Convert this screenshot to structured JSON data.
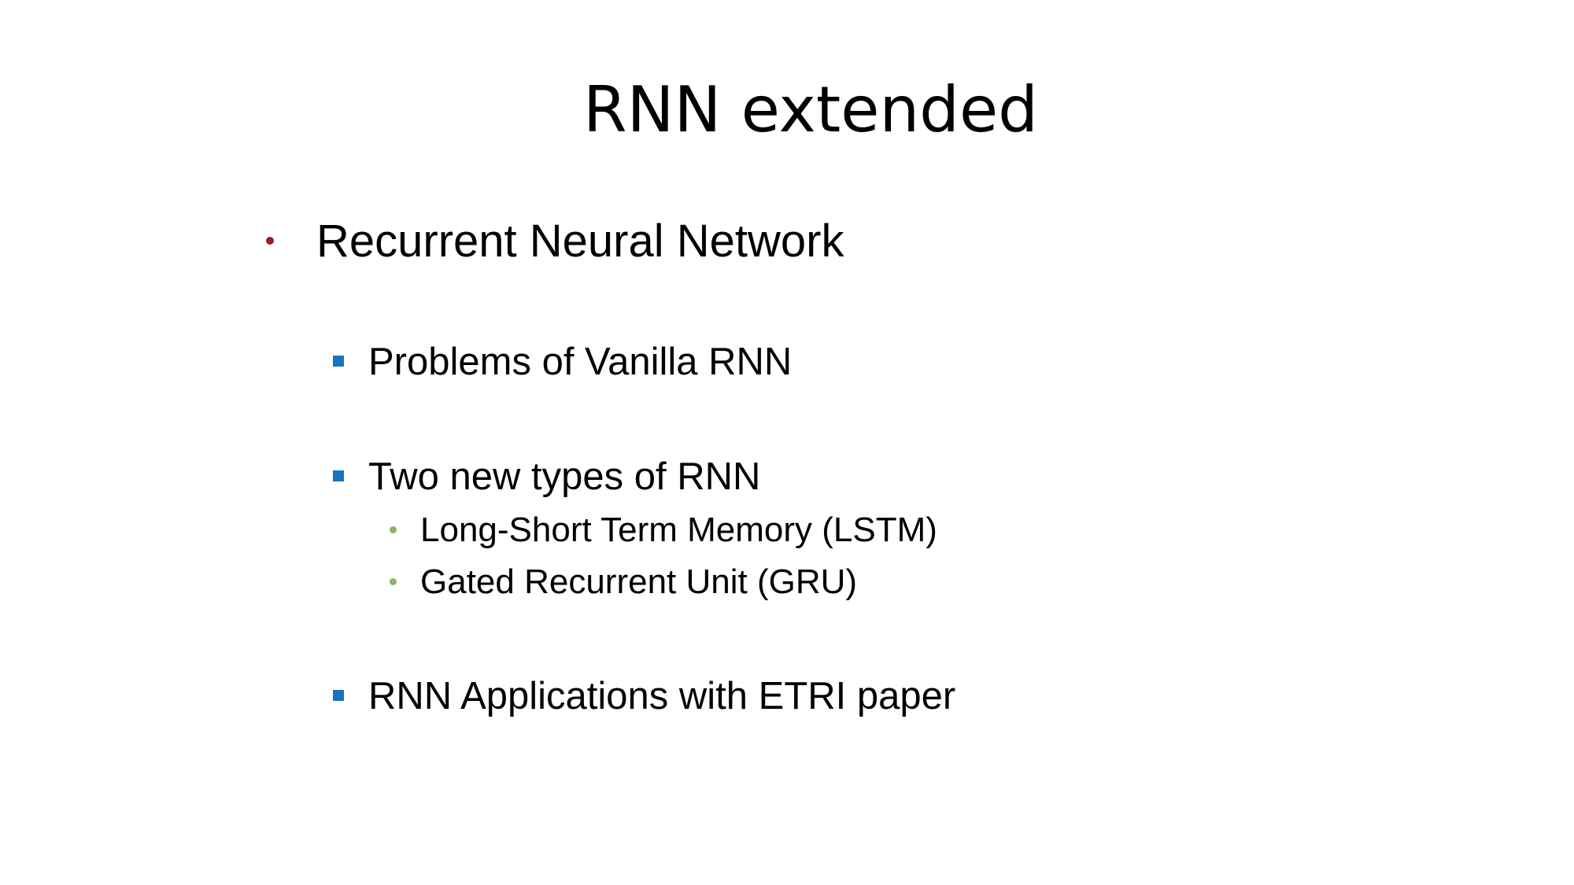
{
  "slide": {
    "title": "RNN extended",
    "main_bullet": "Recurrent Neural Network",
    "sub_bullets": [
      "Problems of Vanilla RNN",
      "Two new types of RNN",
      "RNN Applications with ETRI paper"
    ],
    "sub_sub_bullets": [
      "Long-Short Term Memory (LSTM)",
      "Gated Recurrent Unit (GRU)"
    ]
  },
  "colors": {
    "level1_bullet": "#9b1c1c",
    "level2_bullet": "#1a73c0",
    "level3_bullet": "#8ab55b",
    "text": "#000000",
    "background": "#ffffff"
  }
}
